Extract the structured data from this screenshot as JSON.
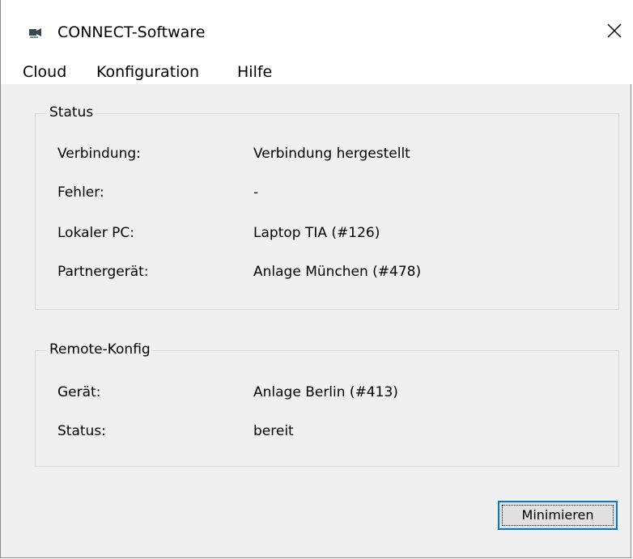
{
  "window": {
    "title": "CONNECT-Software",
    "icon": "connect-app-icon",
    "close_icon": "close-icon"
  },
  "menu": {
    "items": [
      {
        "label": "Cloud"
      },
      {
        "label": "Konfiguration"
      },
      {
        "label": "Hilfe"
      }
    ]
  },
  "status_group": {
    "title": "Status",
    "rows": [
      {
        "label": "Verbindung:",
        "value": "Verbindung hergestellt"
      },
      {
        "label": "Fehler:",
        "value": "-"
      },
      {
        "label": "Lokaler PC:",
        "value": "Laptop TIA (#126)"
      },
      {
        "label": "Partnergerät:",
        "value": "Anlage München (#478)"
      }
    ]
  },
  "remote_group": {
    "title": "Remote-Konfig",
    "rows": [
      {
        "label": "Gerät:",
        "value": "Anlage Berlin (#413)"
      },
      {
        "label": "Status:",
        "value": "bereit"
      }
    ]
  },
  "buttons": {
    "minimize_label": "Minimieren"
  },
  "colors": {
    "focus_border": "#0078d7",
    "window_bg": "#f0f0f0",
    "titlebar_bg": "#ffffff"
  }
}
